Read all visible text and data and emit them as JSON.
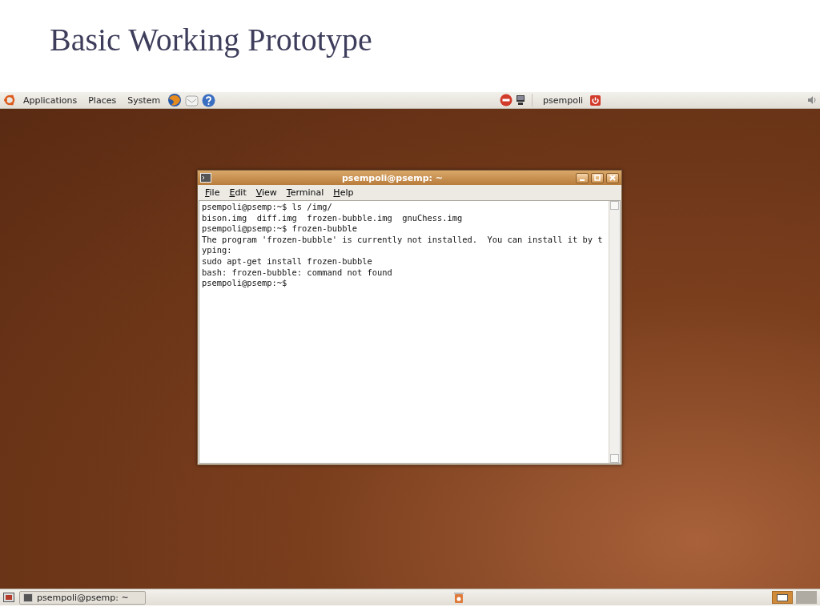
{
  "slide_title": "Basic Working Prototype",
  "top_panel": {
    "menus": [
      "Applications",
      "Places",
      "System"
    ],
    "user": "psempoli"
  },
  "terminal": {
    "title": "psempoli@psemp: ~",
    "menu": [
      "File",
      "Edit",
      "View",
      "Terminal",
      "Help"
    ],
    "lines": [
      "psempoli@psemp:~$ ls /img/",
      "bison.img  diff.img  frozen-bubble.img  gnuChess.img",
      "psempoli@psemp:~$ frozen-bubble",
      "The program 'frozen-bubble' is currently not installed.  You can install it by t",
      "yping:",
      "sudo apt-get install frozen-bubble",
      "bash: frozen-bubble: command not found",
      "psempoli@psemp:~$"
    ]
  },
  "bottom_panel": {
    "tasks": [
      {
        "label": "psempoli@psemp: ~"
      }
    ]
  }
}
